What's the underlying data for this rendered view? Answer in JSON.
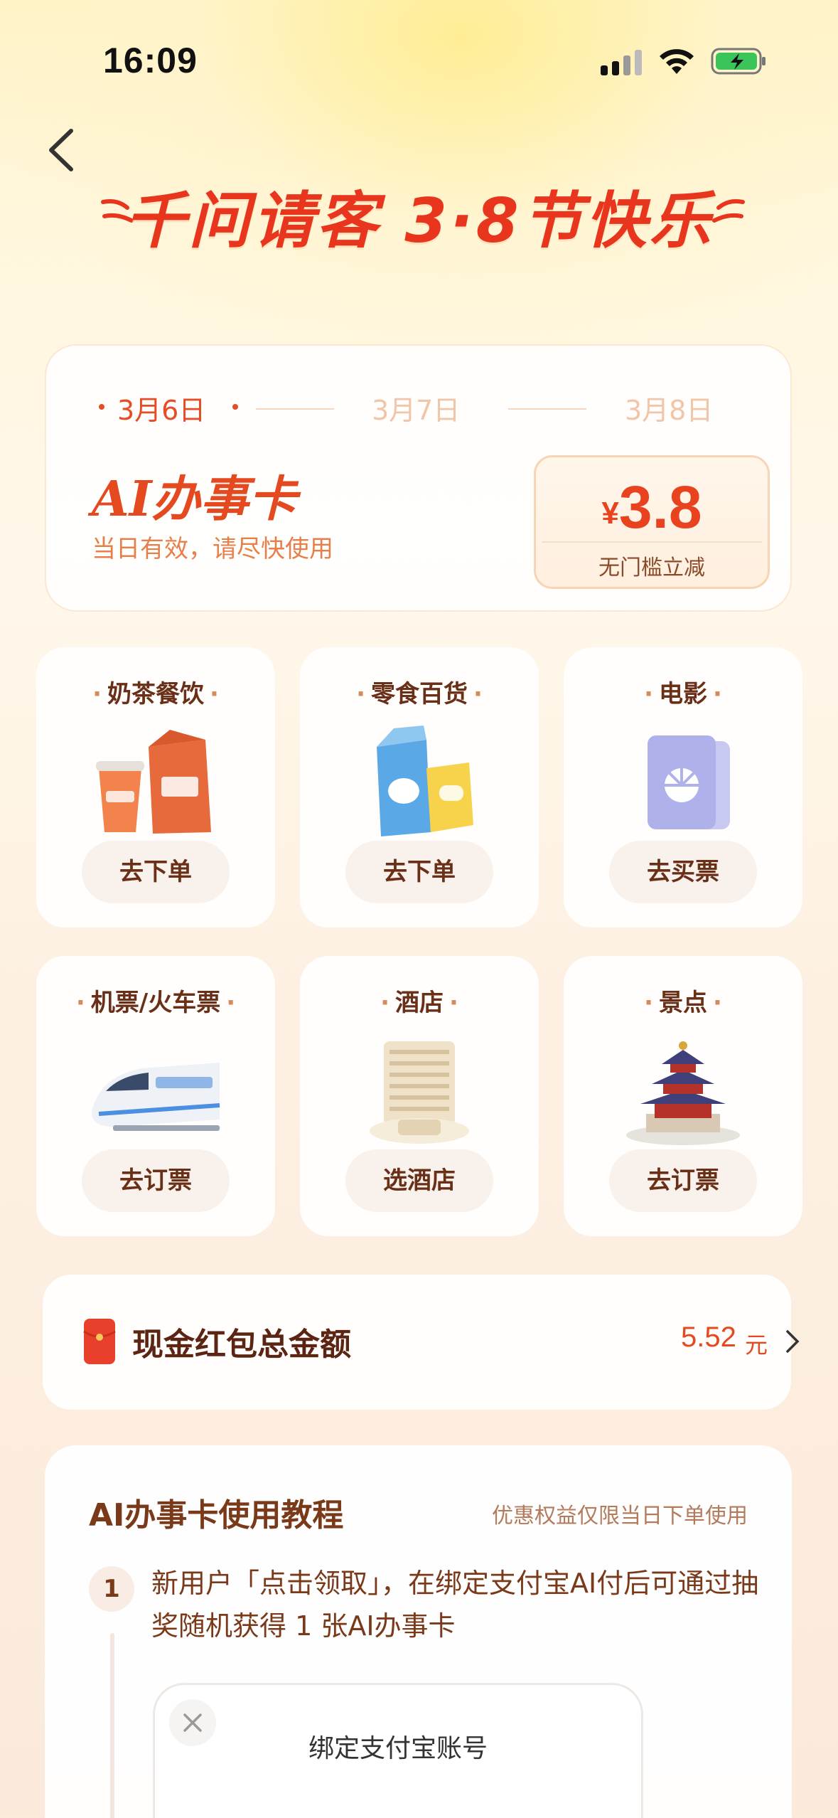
{
  "status_bar": {
    "time": "16:09"
  },
  "hero": {
    "title": "千问请客 3·8节快乐"
  },
  "date_card": {
    "dates": [
      "3月6日",
      "3月7日",
      "3月8日"
    ],
    "active_date_index": 0,
    "title": "AI办事卡",
    "subtitle": "当日有效，请尽快使用",
    "coupon": {
      "currency": "¥",
      "amount": "3.8",
      "note": "无门槛立减"
    }
  },
  "tiles": [
    {
      "title": "奶茶餐饮",
      "button": "去下单",
      "icon": "milk-tea-bag-icon"
    },
    {
      "title": "零食百货",
      "button": "去下单",
      "icon": "snacks-icon"
    },
    {
      "title": "电影",
      "button": "去买票",
      "icon": "movie-ticket-icon"
    },
    {
      "title": "机票/火车票",
      "button": "去订票",
      "icon": "train-icon"
    },
    {
      "title": "酒店",
      "button": "选酒店",
      "icon": "hotel-icon"
    },
    {
      "title": "景点",
      "button": "去订票",
      "icon": "temple-icon"
    }
  ],
  "red_packet": {
    "label": "现金红包总金额",
    "amount": "5.52",
    "unit": "元"
  },
  "tutorial": {
    "title": "AI办事卡使用教程",
    "note": "优惠权益仅限当日下单使用",
    "steps": [
      {
        "number": "1",
        "text": "新用户「点击领取」，在绑定支付宝AI付后可通过抽奖随机获得 1 张AI办事卡"
      }
    ],
    "mock_dialog_title": "绑定支付宝账号"
  },
  "colors": {
    "accent": "#e5491f",
    "brown": "#6a2f17"
  }
}
